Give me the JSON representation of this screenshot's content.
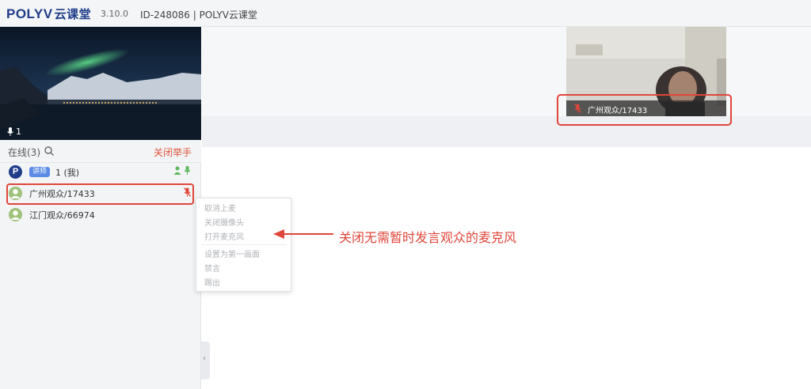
{
  "titlebar": {
    "logo_text": "POLYV",
    "logo_cn": "云课堂",
    "version": "3.10.0",
    "room_info": "ID-248086 | POLYV云课堂"
  },
  "preview": {
    "mic_count": "1"
  },
  "online": {
    "label": "在线(3)",
    "close_hands_label": "关闭举手"
  },
  "users": [
    {
      "avatar": "P",
      "role": "讲师",
      "name": "1 (我)"
    },
    {
      "name": "广州观众/17433"
    },
    {
      "name": "江门观众/66974"
    }
  ],
  "context_menu": {
    "items": [
      "取消上麦",
      "关闭摄像头",
      "打开麦克风",
      "设置为第一画面",
      "禁言",
      "踢出"
    ]
  },
  "camera": {
    "label": "广州观众/17433"
  },
  "annotation": {
    "text": "关闭无需暂时发言观众的麦克风"
  },
  "colors": {
    "brand": "#1f3c88",
    "accent_red": "#e0463a",
    "mic_green": "#5cb85c"
  }
}
